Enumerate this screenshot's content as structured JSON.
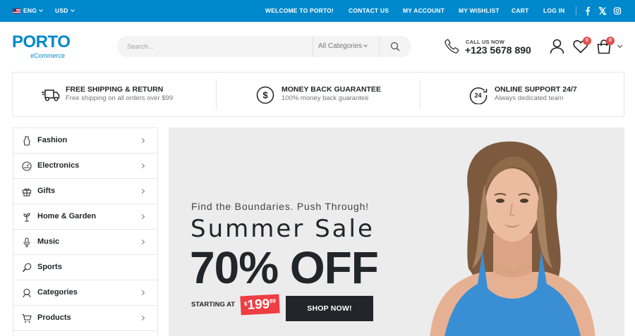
{
  "topbar": {
    "language": "ENG",
    "currency": "USD",
    "welcome": "WELCOME TO PORTO!",
    "links": [
      "CONTACT US",
      "MY ACCOUNT",
      "MY WISHLIST",
      "CART",
      "LOG IN"
    ],
    "social_icons": [
      "facebook-icon",
      "x-icon",
      "instagram-icon"
    ],
    "bg_color": "#0088cc"
  },
  "header": {
    "logo": "PORTO",
    "logo_sub": "eCommerce",
    "search_placeholder": "Search...",
    "category_select": "All Categories",
    "call_label": "CALL US NOW",
    "phone": "+123 5678 890",
    "wishlist_count": "0",
    "cart_count": "0"
  },
  "features": [
    {
      "title": "FREE SHIPPING & RETURN",
      "subtitle": "Free shipping on all orders over $99",
      "icon": "truck-icon"
    },
    {
      "title": "MONEY BACK GUARANTEE",
      "subtitle": "100% money back guarantee",
      "icon": "dollar-circle-icon"
    },
    {
      "title": "ONLINE SUPPORT 24/7",
      "subtitle": "Always dedicated team",
      "icon": "support-24-icon"
    }
  ],
  "sidebar": {
    "items": [
      {
        "label": "Fashion",
        "icon": "dress-icon",
        "has_arrow": true
      },
      {
        "label": "Electronics",
        "icon": "gauge-icon",
        "has_arrow": true
      },
      {
        "label": "Gifts",
        "icon": "gift-icon",
        "has_arrow": true
      },
      {
        "label": "Home & Garden",
        "icon": "plant-icon",
        "has_arrow": true
      },
      {
        "label": "Music",
        "icon": "microphone-icon",
        "has_arrow": true
      },
      {
        "label": "Sports",
        "icon": "racket-icon",
        "has_arrow": false
      },
      {
        "label": "Categories",
        "icon": "badge-icon",
        "has_arrow": true
      },
      {
        "label": "Products",
        "icon": "cart-icon",
        "has_arrow": true
      }
    ]
  },
  "banner": {
    "eyebrow": "Find the Boundaries. Push Through!",
    "title": "Summer Sale",
    "discount": "70% OFF",
    "starting_at": "STARTING AT",
    "price_currency": "$",
    "price_main": "199",
    "price_cents": "99",
    "cta": "SHOP NOW!",
    "accent_color": "#ee3d43"
  }
}
